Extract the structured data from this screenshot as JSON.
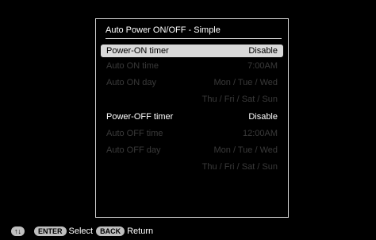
{
  "dialog": {
    "title": "Auto Power ON/OFF - Simple",
    "rows": [
      {
        "label": "Power-ON timer",
        "value": "Disable"
      },
      {
        "label": "Auto ON time",
        "value": "7:00AM"
      },
      {
        "label": "Auto ON day",
        "value": "Mon / Tue / Wed"
      },
      {
        "label": "",
        "value": "Thu / Fri / Sat / Sun"
      },
      {
        "label": "Power-OFF timer",
        "value": "Disable"
      },
      {
        "label": "Auto OFF time",
        "value": "12:00AM"
      },
      {
        "label": "Auto OFF day",
        "value": "Mon / Tue / Wed"
      },
      {
        "label": "",
        "value": "Thu / Fri / Sat / Sun"
      }
    ]
  },
  "footer": {
    "arrows_icon": "up-down-arrows-icon",
    "enter_key": "ENTER",
    "enter_label": "Select",
    "back_key": "BACK",
    "back_label": "Return"
  }
}
